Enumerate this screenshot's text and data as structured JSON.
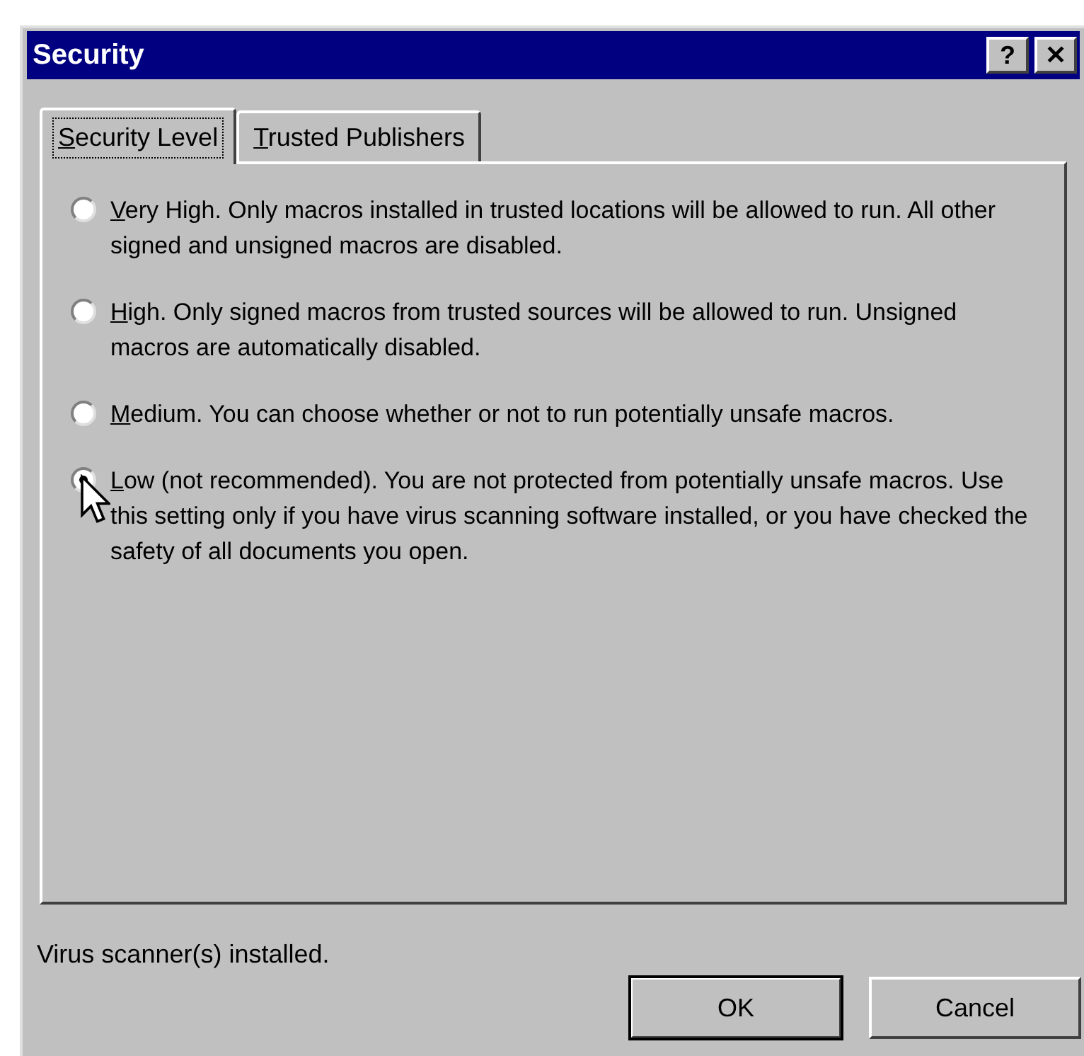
{
  "window": {
    "title": "Security",
    "buttons": [
      "?",
      "✕"
    ]
  },
  "tabs": [
    {
      "label": "Security Level",
      "selected": true
    },
    {
      "label": "Trusted Publishers",
      "selected": false
    }
  ],
  "options": [
    {
      "label": "Very High. Only macros installed in trusted locations will be allowed to run. All other signed and unsigned macros are disabled.",
      "selected": false
    },
    {
      "label": "High. Only signed macros from trusted sources will be allowed to run. Unsigned macros are automatically disabled.",
      "selected": false
    },
    {
      "label": "Medium. You can choose whether or not to run potentially unsafe macros.",
      "selected": false
    },
    {
      "label": "Low (not recommended). You are not protected from potentially unsafe macros. Use this setting only if you have virus scanning software installed, or you have checked the safety of all documents you open.",
      "selected": true
    }
  ],
  "status": "Virus scanner(s) installed.",
  "buttons": [
    {
      "label": "OK",
      "default": true
    },
    {
      "label": "Cancel",
      "default": false
    }
  ]
}
